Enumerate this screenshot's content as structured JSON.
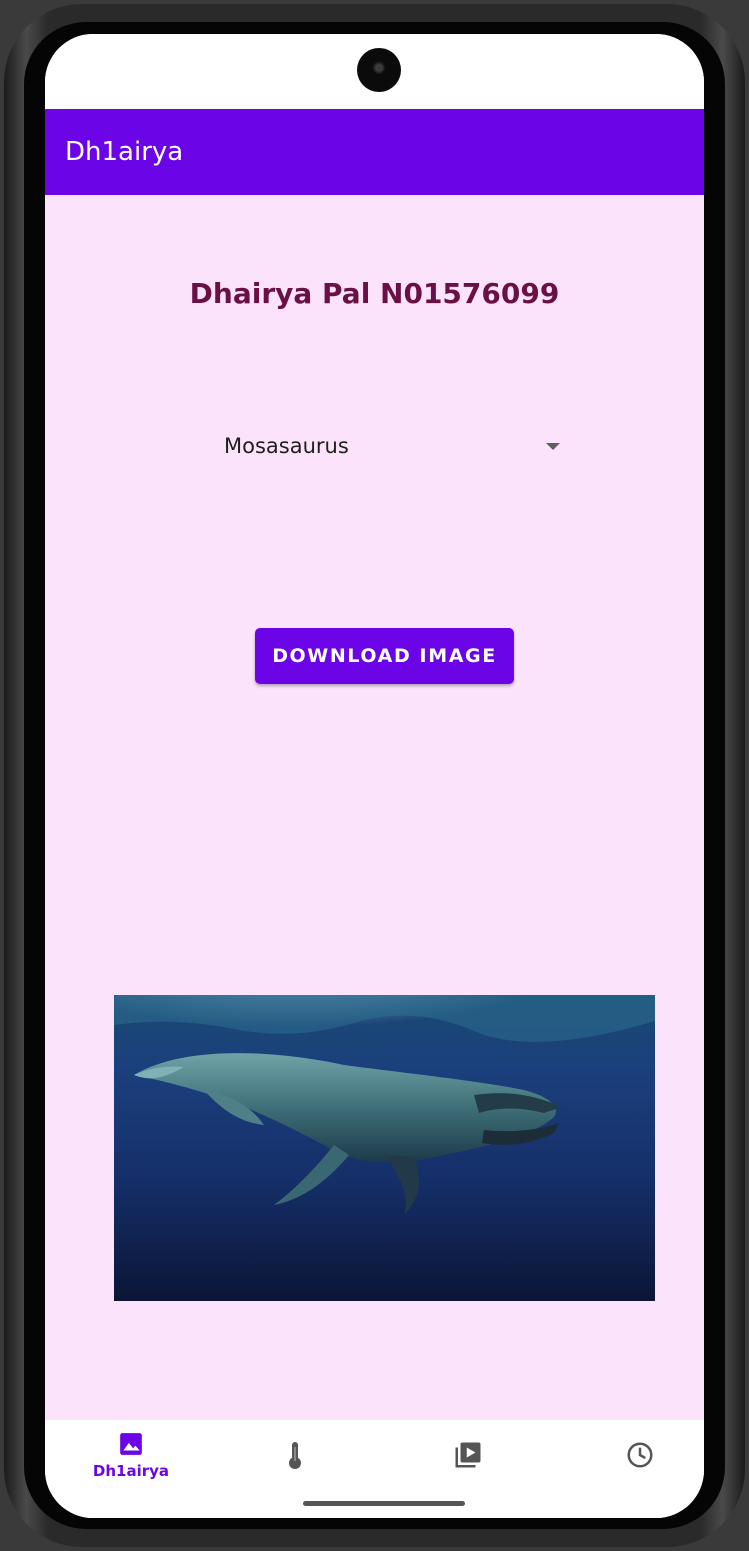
{
  "app_bar": {
    "title": "Dh1airya"
  },
  "main": {
    "heading": "Dhairya Pal N01576099",
    "dropdown": {
      "selected": "Mosasaurus"
    },
    "download_button_label": "DOWNLOAD IMAGE",
    "image": {
      "subject": "mosasaurus-underwater"
    }
  },
  "bottom_nav": {
    "items": [
      {
        "label": "Dh1airya",
        "icon": "image-icon",
        "active": true
      },
      {
        "label": "",
        "icon": "thermometer-icon",
        "active": false
      },
      {
        "label": "",
        "icon": "video-library-icon",
        "active": false
      },
      {
        "label": "",
        "icon": "clock-icon",
        "active": false
      }
    ]
  },
  "colors": {
    "primary": "#6b05e8",
    "background": "#fbe4fb",
    "heading": "#6a1045",
    "nav_inactive": "#555555"
  }
}
